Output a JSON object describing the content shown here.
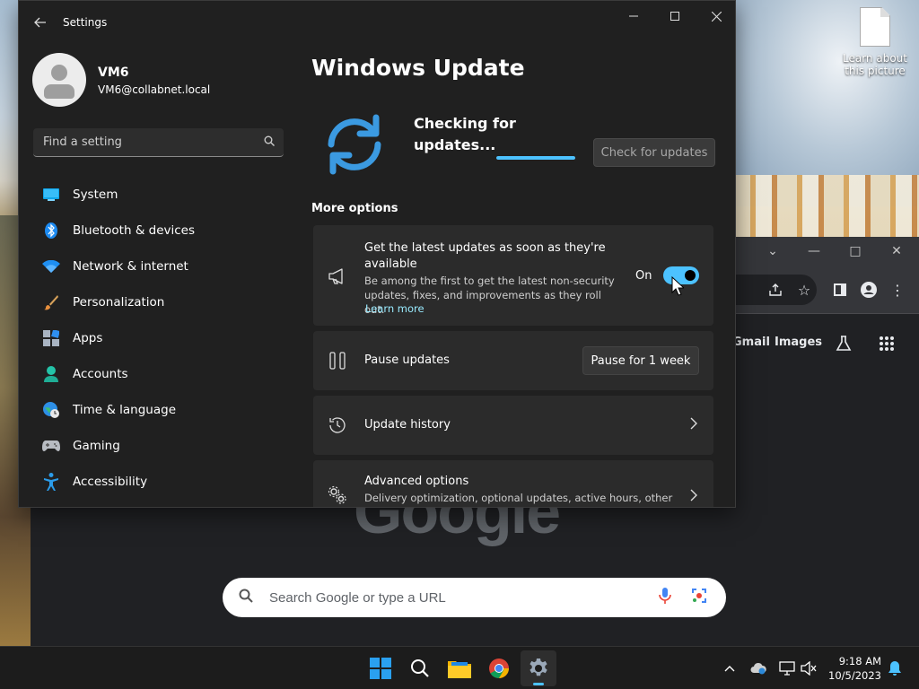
{
  "desktop": {
    "icon_label": "Learn about this picture"
  },
  "browser": {
    "links": {
      "gmail": "Gmail",
      "images": "Images"
    },
    "logo_text": "Google",
    "search_placeholder": "Search Google or type a URL"
  },
  "settings": {
    "title": "Settings",
    "user": {
      "name": "VM6",
      "email": "VM6@collabnet.local"
    },
    "search_placeholder": "Find a setting",
    "nav": [
      {
        "label": "System",
        "icon": "monitor-icon"
      },
      {
        "label": "Bluetooth & devices",
        "icon": "bluetooth-icon"
      },
      {
        "label": "Network & internet",
        "icon": "wifi-icon"
      },
      {
        "label": "Personalization",
        "icon": "brush-icon"
      },
      {
        "label": "Apps",
        "icon": "apps-icon"
      },
      {
        "label": "Accounts",
        "icon": "person-icon"
      },
      {
        "label": "Time & language",
        "icon": "globe-clock-icon"
      },
      {
        "label": "Gaming",
        "icon": "gamepad-icon"
      },
      {
        "label": "Accessibility",
        "icon": "accessibility-icon"
      }
    ],
    "page": {
      "title": "Windows Update",
      "status": "Checking for updates...",
      "progress": 1.0,
      "check_button": "Check for updates",
      "more_options": "More options",
      "latest_updates": {
        "title": "Get the latest updates as soon as they're available",
        "description": "Be among the first to get the latest non-security updates, fixes, and improvements as they roll out.",
        "link": "Learn more",
        "toggle_label": "On",
        "toggle_on": true
      },
      "pause": {
        "title": "Pause updates",
        "button": "Pause for 1 week"
      },
      "history": {
        "title": "Update history"
      },
      "advanced": {
        "title": "Advanced options",
        "description": "Delivery optimization, optional updates, active hours, other"
      }
    },
    "accent_color": "#4cc2ff"
  },
  "taskbar": {
    "apps": [
      "windows-start",
      "search",
      "file-explorer",
      "chrome",
      "settings"
    ],
    "time": "9:18 AM",
    "date": "10/5/2023"
  }
}
